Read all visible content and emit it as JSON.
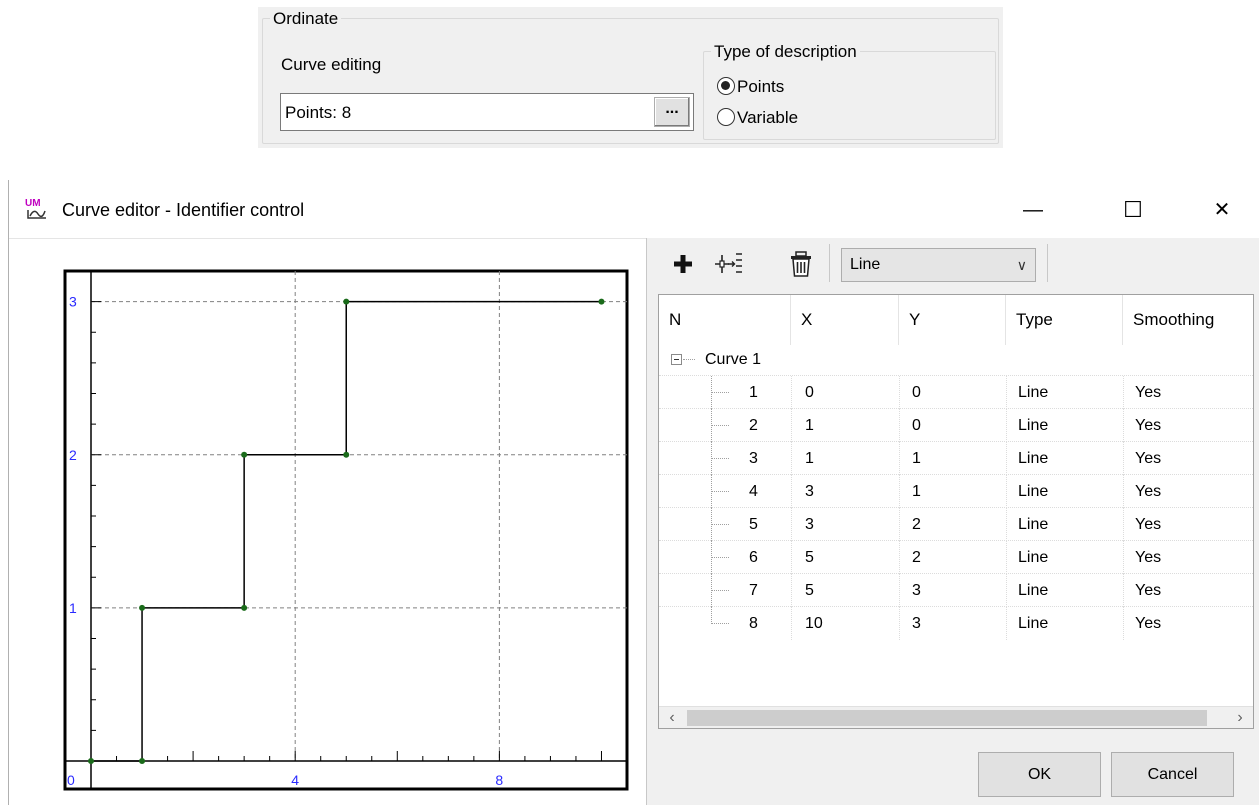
{
  "ordinate": {
    "group_title": "Ordinate",
    "curve_editing_label": "Curve editing",
    "points_field_value": "Points: 8",
    "ellipsis_label": "...",
    "type_group_title": "Type of description",
    "options": [
      {
        "label": "Points",
        "checked": true
      },
      {
        "label": "Variable",
        "checked": false
      }
    ]
  },
  "window": {
    "title": "Curve editor - Identifier control",
    "minimize": "—",
    "maximize": "☐",
    "close": "✕"
  },
  "toolbar": {
    "add_icon": "plus-icon",
    "insert_icon": "insert-point-icon",
    "delete_icon": "trash-icon",
    "type_select_value": "Line"
  },
  "grid": {
    "columns": [
      "N",
      "X",
      "Y",
      "Type",
      "Smoothing"
    ],
    "group_label": "Curve 1",
    "rows": [
      {
        "n": "1",
        "x": "0",
        "y": "0",
        "type": "Line",
        "smoothing": "Yes"
      },
      {
        "n": "2",
        "x": "1",
        "y": "0",
        "type": "Line",
        "smoothing": "Yes"
      },
      {
        "n": "3",
        "x": "1",
        "y": "1",
        "type": "Line",
        "smoothing": "Yes"
      },
      {
        "n": "4",
        "x": "3",
        "y": "1",
        "type": "Line",
        "smoothing": "Yes"
      },
      {
        "n": "5",
        "x": "3",
        "y": "2",
        "type": "Line",
        "smoothing": "Yes"
      },
      {
        "n": "6",
        "x": "5",
        "y": "2",
        "type": "Line",
        "smoothing": "Yes"
      },
      {
        "n": "7",
        "x": "5",
        "y": "3",
        "type": "Line",
        "smoothing": "Yes"
      },
      {
        "n": "8",
        "x": "10",
        "y": "3",
        "type": "Line",
        "smoothing": "Yes"
      }
    ]
  },
  "buttons": {
    "ok": "OK",
    "cancel": "Cancel"
  },
  "chart_data": {
    "type": "line",
    "x": [
      0,
      1,
      1,
      3,
      3,
      5,
      5,
      10
    ],
    "y": [
      0,
      0,
      1,
      1,
      2,
      2,
      3,
      3
    ],
    "xlim": [
      0,
      10.5
    ],
    "ylim": [
      0,
      3.2
    ],
    "xticks": [
      "0",
      "4",
      "8"
    ],
    "yticks": [
      "1",
      "2",
      "3"
    ],
    "grid": true,
    "colors": {
      "line": "#000000",
      "marker": "#1a6b1a",
      "tick_labels": "#2a2aff"
    }
  }
}
